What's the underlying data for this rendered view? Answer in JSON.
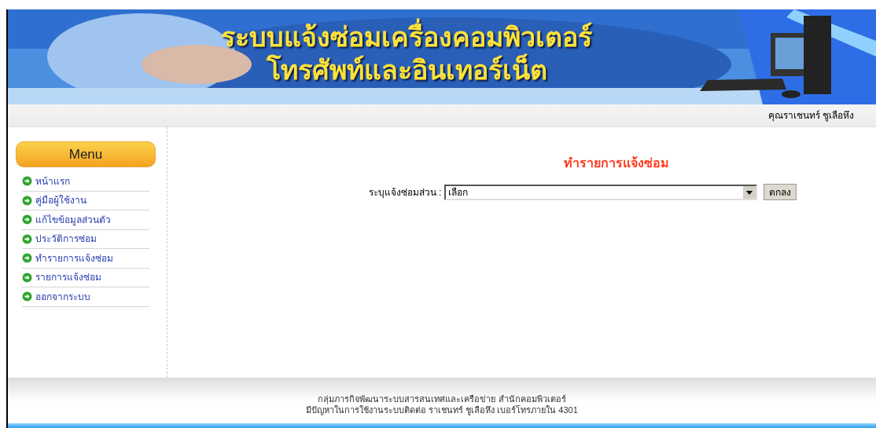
{
  "banner": {
    "title_lines": [
      "ระบบแจ้งซ่อมเครื่องคอมพิวเตอร์",
      "โทรศัพท์และอินเทอร์เน็ต"
    ]
  },
  "user_bar": {
    "user_name": "คุณราเชนทร์ ชูเลือหึง"
  },
  "sidebar": {
    "heading": "Menu",
    "items": [
      {
        "label": "หน้าแรก"
      },
      {
        "label": "คู่มือผู้ใช้งาน"
      },
      {
        "label": "แก้ไขข้อมูลส่วนตัว"
      },
      {
        "label": "ประวัติการซ่อม"
      },
      {
        "label": "ทำรายการแจ้งซ่อม"
      },
      {
        "label": "รายการแจ้งซ่อม"
      },
      {
        "label": "ออกจากระบบ"
      }
    ]
  },
  "main": {
    "title": "ทำรายการแจ้งซ่อม",
    "field_label": "ระบุแจ้งซ่อมส่วน :",
    "select_value": "เลือก",
    "submit_button": "ตกลง"
  },
  "footer": {
    "lines": [
      "กลุ่มภารกิจพัฒนาระบบสารสนเทศและเครือข่าย สำนักคอมพิวเตอร์",
      "มีปัญหาในการใช้งานระบบติดต่อ ราเชนทร์ ชูเลือหึง เบอร์โทรภายใน 4301"
    ]
  }
}
